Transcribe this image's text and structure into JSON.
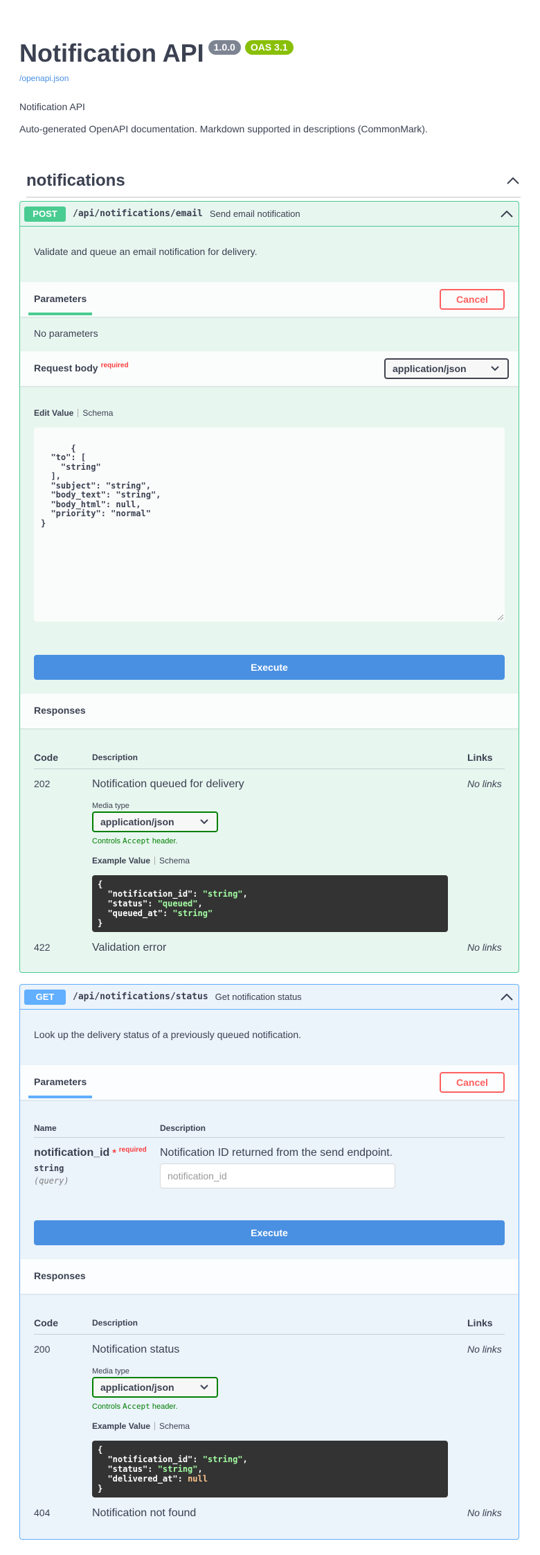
{
  "info": {
    "title": "Notification API",
    "version": "1.0.0",
    "oas": "OAS 3.1",
    "spec_link": "/openapi.json",
    "description": "Notification API",
    "description2": "Auto-generated OpenAPI documentation. Markdown supported in descriptions (CommonMark)."
  },
  "tag": {
    "name": "notifications"
  },
  "post": {
    "method": "POST",
    "path": "/api/notifications/email",
    "summary": "Send email notification",
    "description": "Validate and queue an email notification for delivery.",
    "parameters_label": "Parameters",
    "cancel_label": "Cancel",
    "no_params": "No parameters",
    "request_body_label": "Request body",
    "required_label": "required",
    "content_type": "application/json",
    "edit_value_tab": "Edit Value",
    "schema_tab": "Schema",
    "body": "{\n  \"to\": [\n    \"string\"\n  ],\n  \"subject\": \"string\",\n  \"body_text\": \"string\",\n  \"body_html\": null,\n  \"priority\": \"normal\"\n}",
    "execute_label": "Execute",
    "responses_label": "Responses",
    "col_code": "Code",
    "col_description": "Description",
    "col_links": "Links",
    "responses": [
      {
        "code": "202",
        "description": "Notification queued for delivery",
        "links": "No links"
      },
      {
        "code": "422",
        "description": "Validation error",
        "links": "No links"
      }
    ],
    "media_type_label": "Media type",
    "media_type": "application/json",
    "controls_note_pre": "Controls ",
    "controls_note_code": "Accept",
    "controls_note_post": " header.",
    "example_tab": "Example Value",
    "example_schema_tab": "Schema",
    "example": {
      "notification_id_key": "\"notification_id\"",
      "notification_id_val": "\"string\"",
      "status_key": "\"status\"",
      "status_val": "\"queued\"",
      "queued_at_key": "\"queued_at\"",
      "queued_at_val": "\"string\""
    }
  },
  "get": {
    "method": "GET",
    "path": "/api/notifications/status",
    "summary": "Get notification status",
    "description": "Look up the delivery status of a previously queued notification.",
    "parameters_label": "Parameters",
    "cancel_label": "Cancel",
    "col_name": "Name",
    "col_description": "Description",
    "param": {
      "name": "notification_id",
      "star": "*",
      "required_label": "required",
      "type": "string",
      "in": "(query)",
      "description": "Notification ID returned from the send endpoint.",
      "placeholder": "notification_id"
    },
    "execute_label": "Execute",
    "responses_label": "Responses",
    "col_code": "Code",
    "col_links": "Links",
    "responses": [
      {
        "code": "200",
        "description": "Notification status",
        "links": "No links"
      },
      {
        "code": "404",
        "description": "Notification not found",
        "links": "No links"
      }
    ],
    "media_type_label": "Media type",
    "media_type": "application/json",
    "controls_note_pre": "Controls ",
    "controls_note_code": "Accept",
    "controls_note_post": " header.",
    "example_tab": "Example Value",
    "example_schema_tab": "Schema",
    "example": {
      "notification_id_key": "\"notification_id\"",
      "notification_id_val": "\"string\"",
      "status_key": "\"status\"",
      "status_val": "\"string\"",
      "delivered_at_key": "\"delivered_at\"",
      "delivered_at_val": "null"
    }
  },
  "colors": {
    "post": "#49cc90",
    "get": "#61affe",
    "execute": "#4990e2",
    "cancel": "#ff6060",
    "text": "#3b4151"
  },
  "icons": [
    "chevron-up-icon",
    "chevron-down-icon",
    "resize-handle-icon"
  ]
}
